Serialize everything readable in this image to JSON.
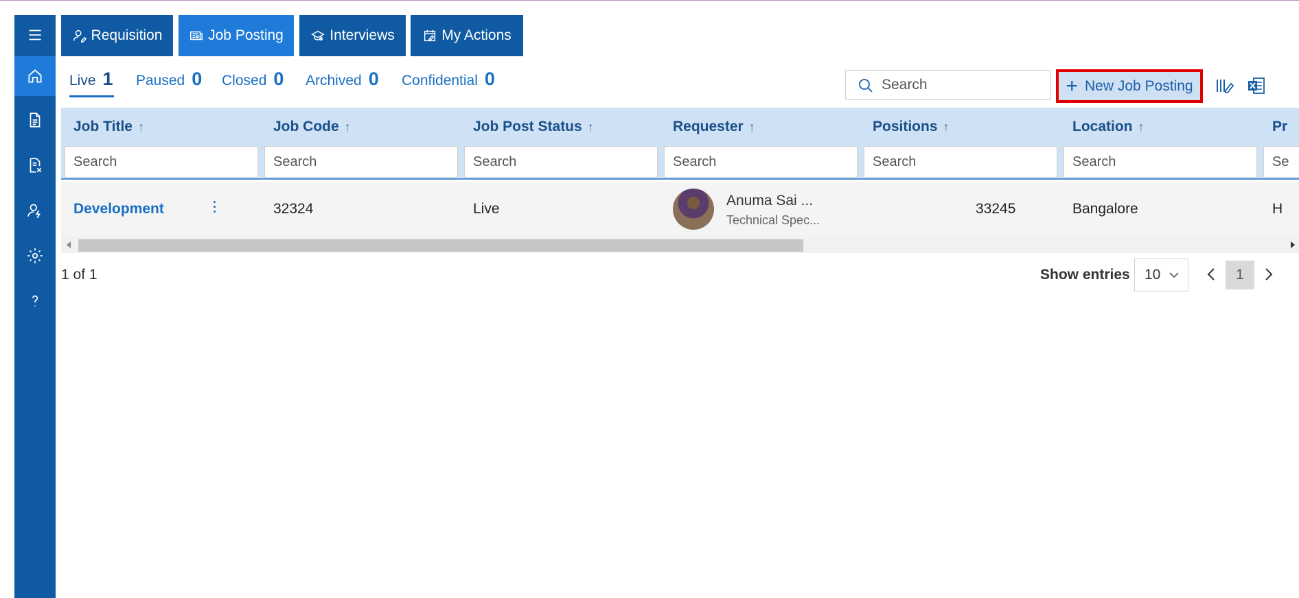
{
  "top_tabs": [
    {
      "label": "Requisition",
      "icon": "person-edit-icon"
    },
    {
      "label": "Job Posting",
      "icon": "news-icon"
    },
    {
      "label": "Interviews",
      "icon": "interview-icon"
    },
    {
      "label": "My Actions",
      "icon": "calendar-edit-icon"
    }
  ],
  "sidebar": {
    "items": [
      {
        "icon": "menu-icon"
      },
      {
        "icon": "home-icon"
      },
      {
        "icon": "document-icon"
      },
      {
        "icon": "document-dismiss-icon"
      },
      {
        "icon": "person-lightning-icon"
      },
      {
        "icon": "gear-icon"
      },
      {
        "icon": "help-icon"
      }
    ]
  },
  "status_tabs": [
    {
      "label": "Live",
      "count": "1"
    },
    {
      "label": "Paused",
      "count": "0"
    },
    {
      "label": "Closed",
      "count": "0"
    },
    {
      "label": "Archived",
      "count": "0"
    },
    {
      "label": "Confidential",
      "count": "0"
    }
  ],
  "toolbar": {
    "search_placeholder": "Search",
    "new_button_label": "New Job Posting",
    "new_button_icon": "+"
  },
  "grid": {
    "columns": [
      {
        "label": "Job Title",
        "arrow": "↑",
        "filter_placeholder": "Search"
      },
      {
        "label": "Job Code",
        "arrow": "↑",
        "filter_placeholder": "Search"
      },
      {
        "label": "Job Post Status",
        "arrow": "↑",
        "filter_placeholder": "Search"
      },
      {
        "label": "Requester",
        "arrow": "↑",
        "filter_placeholder": "Search"
      },
      {
        "label": "Positions",
        "arrow": "↑",
        "filter_placeholder": "Search"
      },
      {
        "label": "Location",
        "arrow": "↑",
        "filter_placeholder": "Search"
      },
      {
        "label": "Pr",
        "arrow": "",
        "filter_placeholder": "Se"
      }
    ],
    "rows": [
      {
        "job_title": "Development",
        "job_code": "32324",
        "status": "Live",
        "requester_name": "Anuma Sai ...",
        "requester_title": "Technical Spec...",
        "positions": "33245",
        "location": "Bangalore",
        "extra": "H"
      }
    ]
  },
  "footer": {
    "page_info": "1 of 1",
    "show_entries_label": "Show entries",
    "entries_value": "10",
    "current_page": "1"
  },
  "colors": {
    "sidebar": "#0f5aa3",
    "active_tab": "#1f7bd9",
    "header_bg": "#cfe1f4",
    "link": "#1a6fc4",
    "highlight_border": "#e00000"
  }
}
